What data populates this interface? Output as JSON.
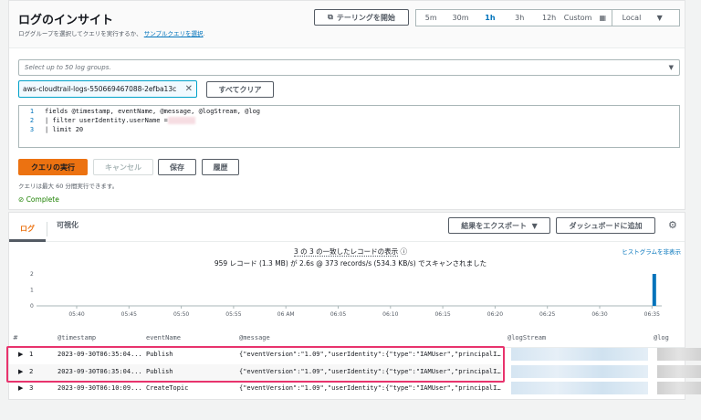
{
  "header": {
    "title": "ログのインサイト",
    "subtitle": "ロググループを選択してクエリを実行するか、",
    "sample_link": "サンプルクエリを選択",
    "subtitle_end": ".",
    "tail_button": "テーリングを開始"
  },
  "time_range": {
    "options": [
      "5m",
      "30m",
      "1h",
      "3h",
      "12h",
      "Custom"
    ],
    "selected": "1h",
    "timezone": "Local"
  },
  "log_groups": {
    "placeholder": "Select up to 50 log groups.",
    "selected": "aws-cloudtrail-logs-550669467088-2efba13c",
    "clear_all": "すべてクリア"
  },
  "editor": {
    "lines": [
      {
        "n": "1",
        "text": "fields @timestamp, eventName, @message, @logStream, @log"
      },
      {
        "n": "2",
        "text": "| filter userIdentity.userName = "
      },
      {
        "n": "3",
        "text": "| limit 20"
      }
    ]
  },
  "actions": {
    "run": "クエリの実行",
    "cancel": "キャンセル",
    "save": "保存",
    "history": "履歴",
    "note": "クエリは最大 60 分間実行できます。",
    "status": "Complete"
  },
  "results": {
    "tabs": [
      "ログ",
      "可視化"
    ],
    "active_tab": "ログ",
    "export": "結果をエクスポート",
    "add_dashboard": "ダッシュボードに追加",
    "summary": "3 の 3 の一致したレコードの表示",
    "scan": "959 レコード (1.3 MB) が 2.6s @ 373 records/s (534.3 KB/s) でスキャンされました",
    "hide_histogram": "ヒストグラムを非表示"
  },
  "chart_data": {
    "type": "bar",
    "x_ticks": [
      "05:40",
      "05:45",
      "05:50",
      "05:55",
      "06 AM",
      "06:05",
      "06:10",
      "06:15",
      "06:20",
      "06:25",
      "06:30",
      "06:35"
    ],
    "y_ticks": [
      "2",
      "1",
      "0"
    ],
    "ylim": [
      0,
      2
    ],
    "bars": [
      {
        "x": "06:35",
        "value": 2
      }
    ],
    "color": "#0073bb"
  },
  "table": {
    "columns": [
      "#",
      "@timestamp",
      "eventName",
      "@message",
      "@logStream",
      "@log"
    ],
    "rows": [
      {
        "n": "1",
        "ts": "2023-09-30T06:35:04...",
        "event": "Publish",
        "msg": "{\"eventVersion\":\"1.09\",\"userIdentity\":{\"type\":\"IAMUser\",\"principalI…"
      },
      {
        "n": "2",
        "ts": "2023-09-30T06:35:04...",
        "event": "Publish",
        "msg": "{\"eventVersion\":\"1.09\",\"userIdentity\":{\"type\":\"IAMUser\",\"principalI…"
      },
      {
        "n": "3",
        "ts": "2023-09-30T06:10:09...",
        "event": "CreateTopic",
        "msg": "{\"eventVersion\":\"1.09\",\"userIdentity\":{\"type\":\"IAMUser\",\"principalI…"
      }
    ]
  },
  "colors": {
    "accent": "#ec7211",
    "link": "#0073bb",
    "highlight": "#e8336d",
    "success": "#1d8102"
  }
}
